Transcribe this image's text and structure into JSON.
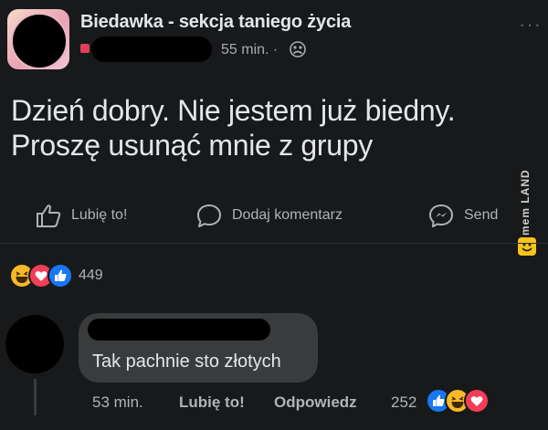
{
  "post": {
    "group_name": "Biedawka - sekcja taniego życia",
    "time": "55 min. ·",
    "text_line1": "Dzień dobry. Nie jestem już biedny.",
    "text_line2": "Proszę usunąć mnie z grupy",
    "more": "···"
  },
  "actions": {
    "like": "Lubię to!",
    "comment": "Dodaj komentarz",
    "send": "Send"
  },
  "reactions": {
    "count": "449",
    "types": [
      "haha-icon",
      "love-icon",
      "like-icon"
    ]
  },
  "comment": {
    "text": "Tak pachnie sto złotych",
    "time": "53 min.",
    "like": "Lubię to!",
    "reply": "Odpowiedz",
    "reaction_count": "252",
    "reaction_types": [
      "like-icon",
      "haha-icon",
      "love-icon"
    ]
  },
  "watermark": {
    "text": "mem LAND"
  },
  "colors": {
    "background": "#18191a",
    "bubble": "#3a3b3c",
    "text": "#e4e6eb",
    "muted": "#b0b3b8",
    "like_blue": "#1877f2",
    "love_red": "#f33e58",
    "haha_yellow": "#f7b928"
  }
}
